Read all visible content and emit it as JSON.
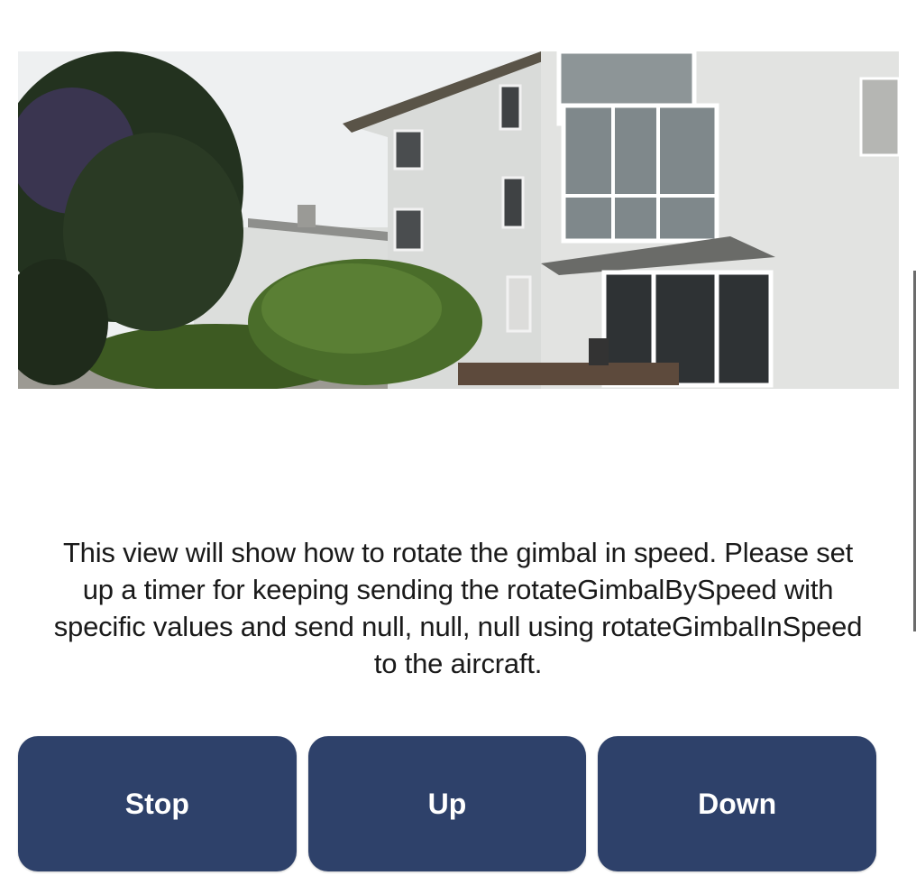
{
  "video": {
    "description_icon": "camera-feed-image"
  },
  "description": "This view will show how to rotate the gimbal in speed. Please set\nup a timer for keeping sending the rotateGimbalBySpeed with\nspecific values and send null, null, null using rotateGimbalInSpeed\nto the aircraft.",
  "buttons": {
    "stop": "Stop",
    "up": "Up",
    "down": "Down"
  },
  "colors": {
    "button_bg": "#2e416a",
    "button_text": "#ffffff"
  }
}
